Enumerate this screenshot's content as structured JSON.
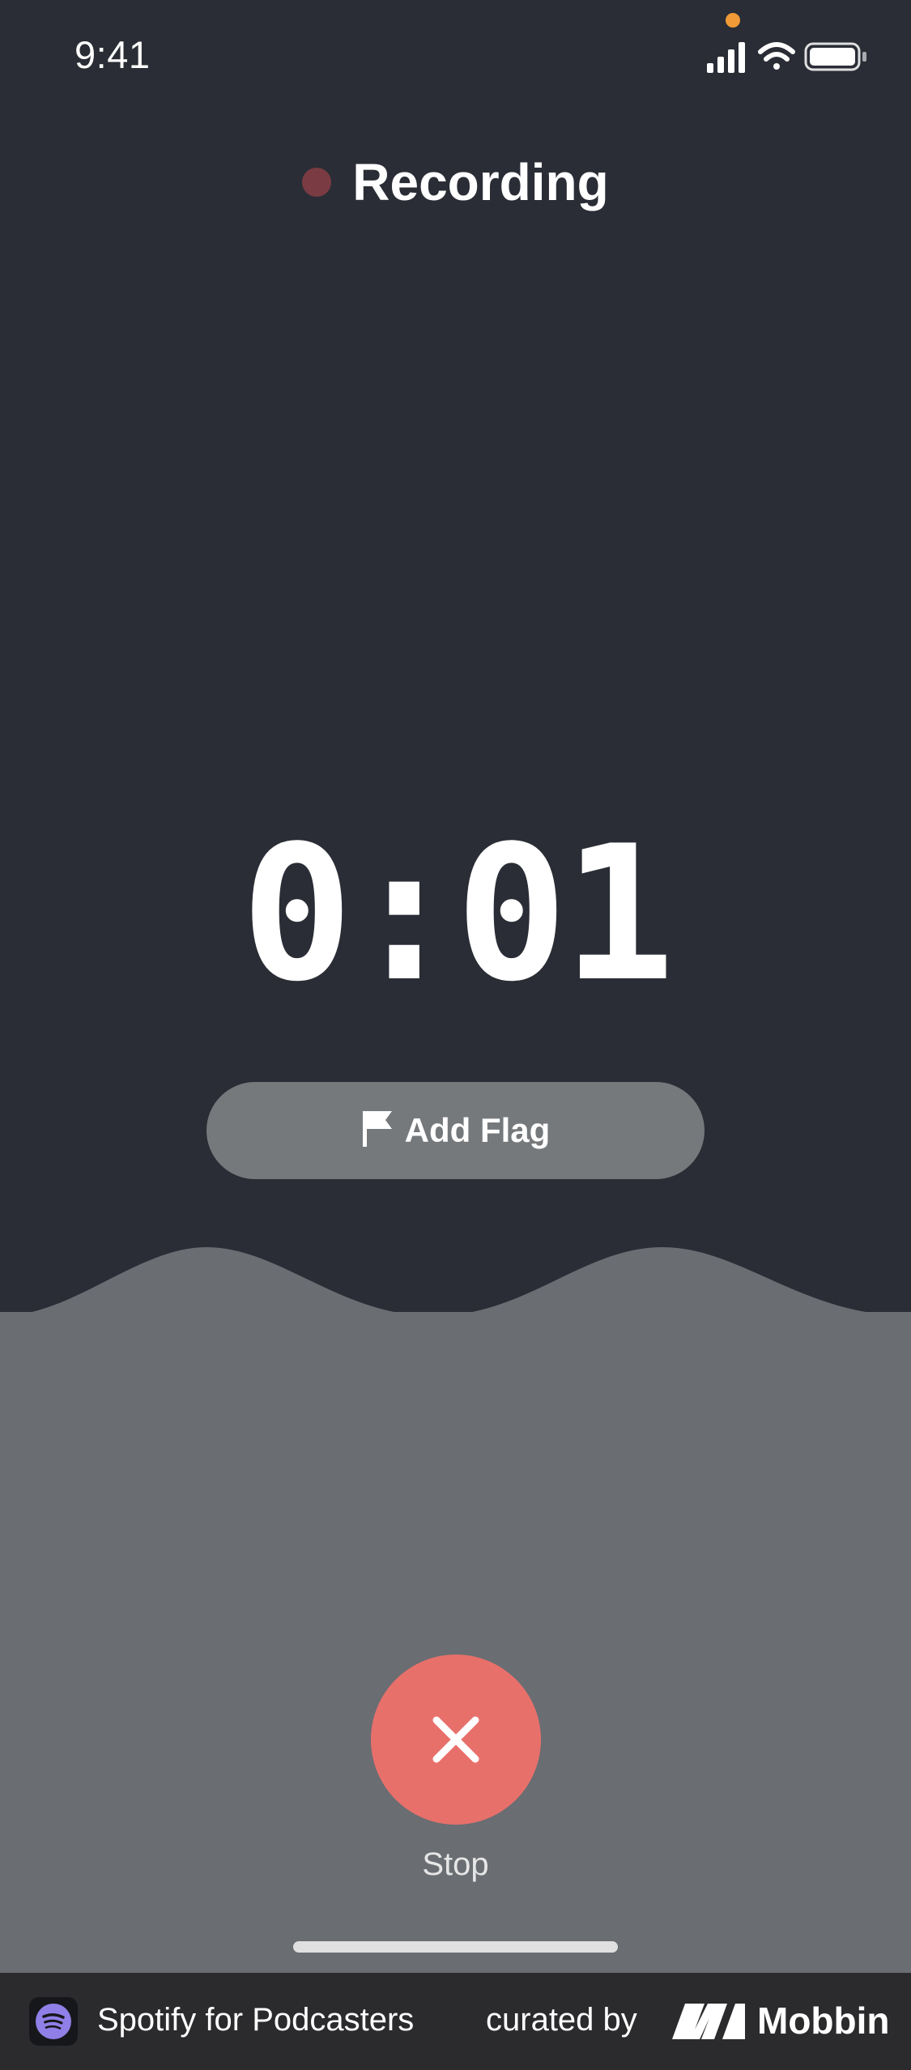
{
  "status_bar": {
    "time": "9:41",
    "icons": [
      "signal-icon",
      "wifi-icon",
      "battery-icon"
    ],
    "mic_indicator_color": "#f09a37"
  },
  "header": {
    "title": "Recording",
    "dot_color": "#7a3b43"
  },
  "timer": {
    "value": "0:01"
  },
  "flag_button": {
    "label": "Add Flag",
    "icon": "flag-icon"
  },
  "stop_button": {
    "label": "Stop",
    "icon": "close-icon",
    "color": "#e8706b"
  },
  "footer": {
    "app_name": "Spotify for Podcasters",
    "curated_label": "curated by",
    "brand": "Mobbin"
  },
  "colors": {
    "background_top": "#2a2d35",
    "background_bottom": "#6a6d72",
    "flag_button": "#76797c",
    "footer": "#2b2b2d",
    "spotify_accent": "#8f7fe6"
  }
}
